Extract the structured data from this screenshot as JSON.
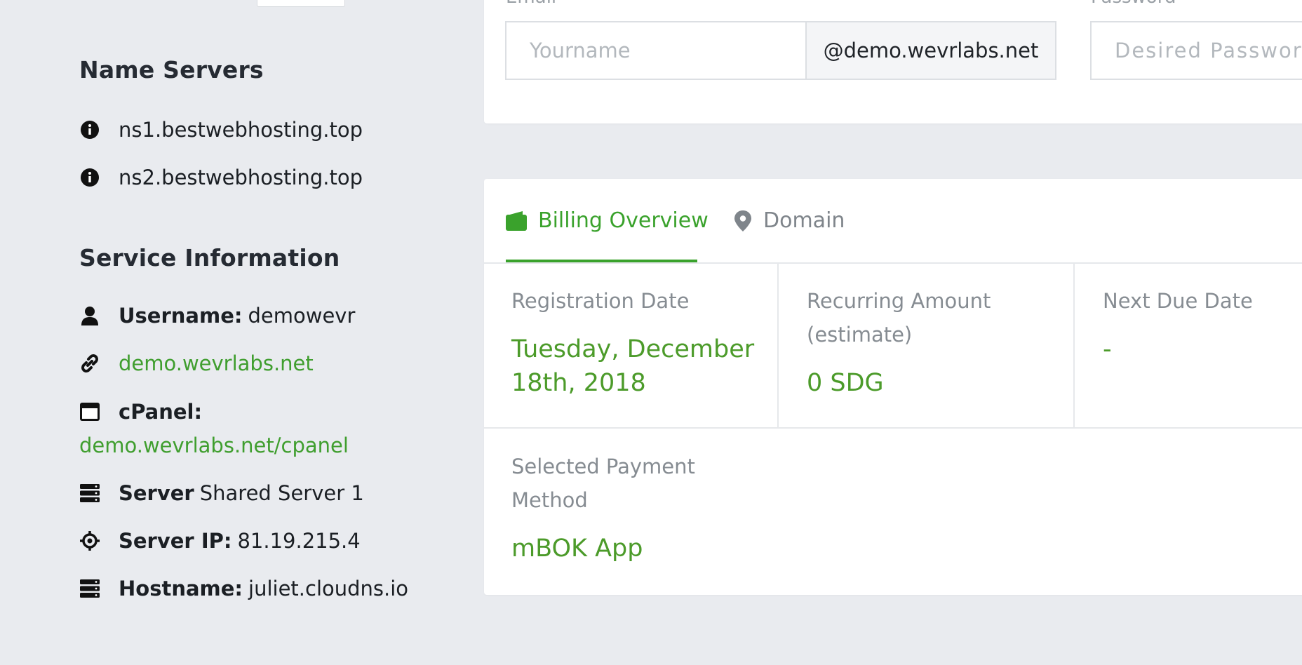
{
  "name_servers": {
    "title": "Name Servers",
    "items": [
      "ns1.bestwebhosting.top",
      "ns2.bestwebhosting.top"
    ]
  },
  "service_info": {
    "title": "Service Information",
    "username_label": "Username:",
    "username_value": "demowevr",
    "domain_link": "demo.wevrlabs.net",
    "cpanel_label": "cPanel:",
    "cpanel_link": "demo.wevrlabs.net/cpanel",
    "server_label": "Server",
    "server_value": "Shared Server 1",
    "server_ip_label": "Server IP:",
    "server_ip_value": "81.19.215.4",
    "hostname_label": "Hostname:",
    "hostname_value": "juliet.cloudns.io"
  },
  "email_form": {
    "email_label": "Email",
    "email_placeholder": "Yourname",
    "email_suffix": "@demo.wevrlabs.net",
    "password_label": "Password",
    "password_placeholder": "Desired Password"
  },
  "tabs": [
    {
      "label": "Billing Overview",
      "icon": "wallet-icon",
      "active": true
    },
    {
      "label": "Domain",
      "icon": "map-pin-icon",
      "active": false
    }
  ],
  "billing": {
    "registration_label": "Registration Date",
    "registration_value": "Tuesday, December 18th, 2018",
    "recurring_label": "Recurring Amount (estimate)",
    "recurring_value": "0 SDG",
    "next_due_label": "Next Due Date",
    "next_due_value": "-",
    "payment_label": "Selected Payment Method",
    "payment_value": "mBOK App"
  },
  "colors": {
    "accent": "#3aa22c",
    "link": "#3f9e2e",
    "background": "#e9ebef",
    "card": "#ffffff"
  }
}
